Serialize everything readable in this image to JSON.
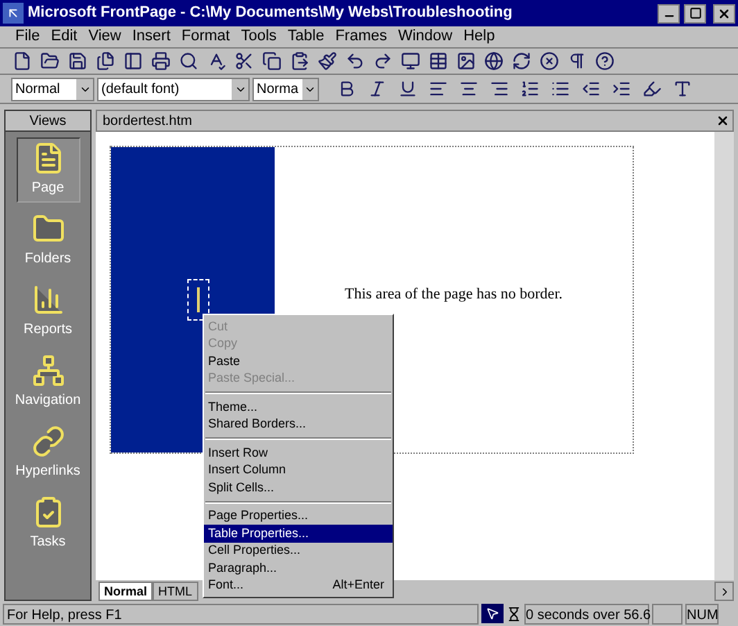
{
  "window": {
    "title": "Microsoft FrontPage - C:\\My Documents\\My Webs\\Troubleshooting"
  },
  "menu": [
    "File",
    "Edit",
    "View",
    "Insert",
    "Format",
    "Tools",
    "Table",
    "Frames",
    "Window",
    "Help"
  ],
  "format_bar": {
    "style": "Normal",
    "font": "(default font)",
    "size": "Norma"
  },
  "views": {
    "title": "Views",
    "items": [
      {
        "label": "Page",
        "selected": true
      },
      {
        "label": "Folders",
        "selected": false
      },
      {
        "label": "Reports",
        "selected": false
      },
      {
        "label": "Navigation",
        "selected": false
      },
      {
        "label": "Hyperlinks",
        "selected": false
      },
      {
        "label": "Tasks",
        "selected": false
      }
    ]
  },
  "document": {
    "tab": "bordertest.htm",
    "cell_text": "This area of the page has no border."
  },
  "page_tabs": [
    {
      "label": "Normal",
      "selected": true
    },
    {
      "label": "HTML",
      "selected": false
    }
  ],
  "context_menu": [
    {
      "kind": "item",
      "label": "Cut",
      "disabled": true,
      "selected": false
    },
    {
      "kind": "item",
      "label": "Copy",
      "disabled": true,
      "selected": false
    },
    {
      "kind": "item",
      "label": "Paste",
      "disabled": false,
      "selected": false
    },
    {
      "kind": "item",
      "label": "Paste Special...",
      "disabled": true,
      "selected": false
    },
    {
      "kind": "separator"
    },
    {
      "kind": "item",
      "label": "Theme...",
      "disabled": false,
      "selected": false
    },
    {
      "kind": "item",
      "label": "Shared Borders...",
      "disabled": false,
      "selected": false
    },
    {
      "kind": "separator"
    },
    {
      "kind": "item",
      "label": "Insert Row",
      "disabled": false,
      "selected": false
    },
    {
      "kind": "item",
      "label": "Insert Column",
      "disabled": false,
      "selected": false
    },
    {
      "kind": "item",
      "label": "Split Cells...",
      "disabled": false,
      "selected": false
    },
    {
      "kind": "separator"
    },
    {
      "kind": "item",
      "label": "Page Properties...",
      "disabled": false,
      "selected": false
    },
    {
      "kind": "item",
      "label": "Table Properties...",
      "disabled": false,
      "selected": true
    },
    {
      "kind": "item",
      "label": "Cell Properties...",
      "disabled": false,
      "selected": false
    },
    {
      "kind": "item",
      "label": "Paragraph...",
      "disabled": false,
      "selected": false
    },
    {
      "kind": "item",
      "label": "Font...",
      "shortcut": "Alt+Enter",
      "disabled": false,
      "selected": false
    }
  ],
  "status_bar": {
    "help": "For Help, press F1",
    "timing": "0 seconds over 56.6",
    "num": "NUM"
  }
}
